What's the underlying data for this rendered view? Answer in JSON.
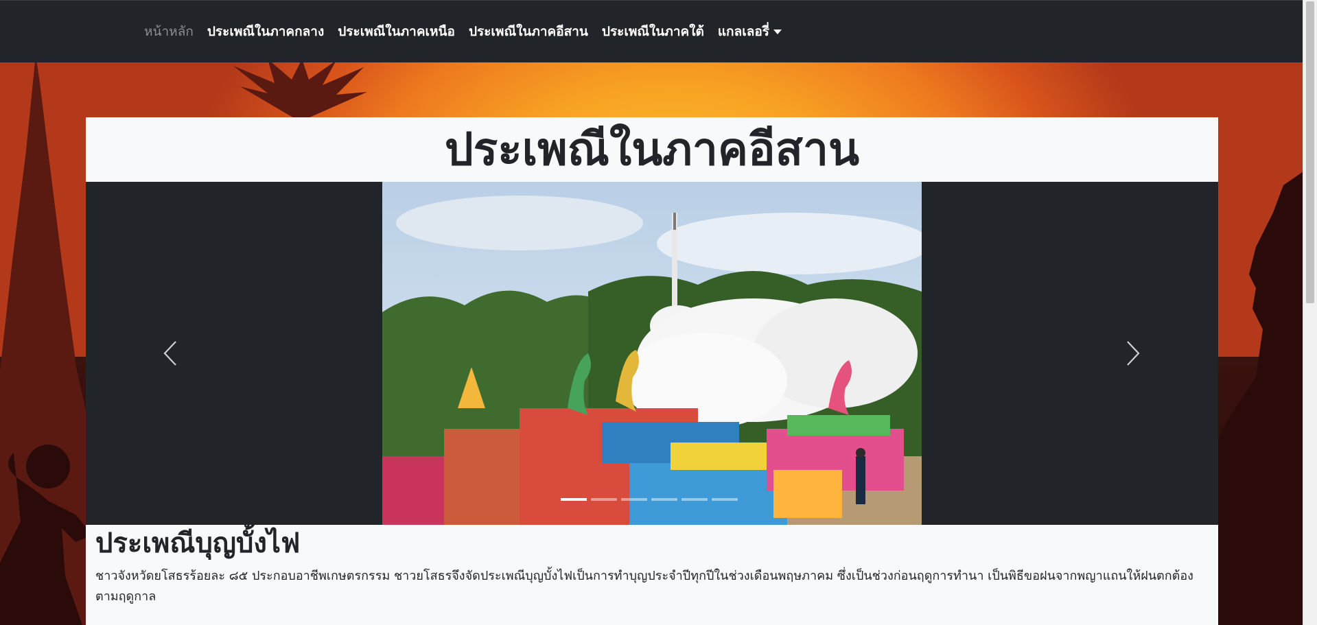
{
  "nav": {
    "items": [
      {
        "label": "หน้าหลัก",
        "muted": true
      },
      {
        "label": "ประเพณีในภาคกลาง"
      },
      {
        "label": "ประเพณีในภาคเหนือ"
      },
      {
        "label": "ประเพณีในภาคอีสาน"
      },
      {
        "label": "ประเพณีในภาคใต้"
      },
      {
        "label": "แกลเลอรี่",
        "dropdown": true
      }
    ]
  },
  "page": {
    "title": "ประเพณีในภาคอีสาน"
  },
  "carousel": {
    "slide_count": 6,
    "active_index": 0,
    "prev_icon": "chevron-left-icon",
    "next_icon": "chevron-right-icon"
  },
  "caption": {
    "title": "ประเพณีบุญบั้งไฟ",
    "text": "ชาวจังหวัดยโสธรร้อยละ ๘๕ ประกอบอาชีพเกษตรกรรม ชาวยโสธรจึงจัดประเพณีบุญบั้งไฟเป็นการทำบุญประจำปีทุกปีในช่วงเดือนพฤษภาคม ซึ่งเป็นช่วงก่อนฤดูการทำนา เป็นพิธีขอฝนจากพญาแถนให้ฝนตกต้องตามฤดูกาล"
  },
  "colors": {
    "navbar": "#212529",
    "card": "#f8f9fa",
    "sky_center": "#fbc02a",
    "sky_edge": "#b3391a"
  }
}
